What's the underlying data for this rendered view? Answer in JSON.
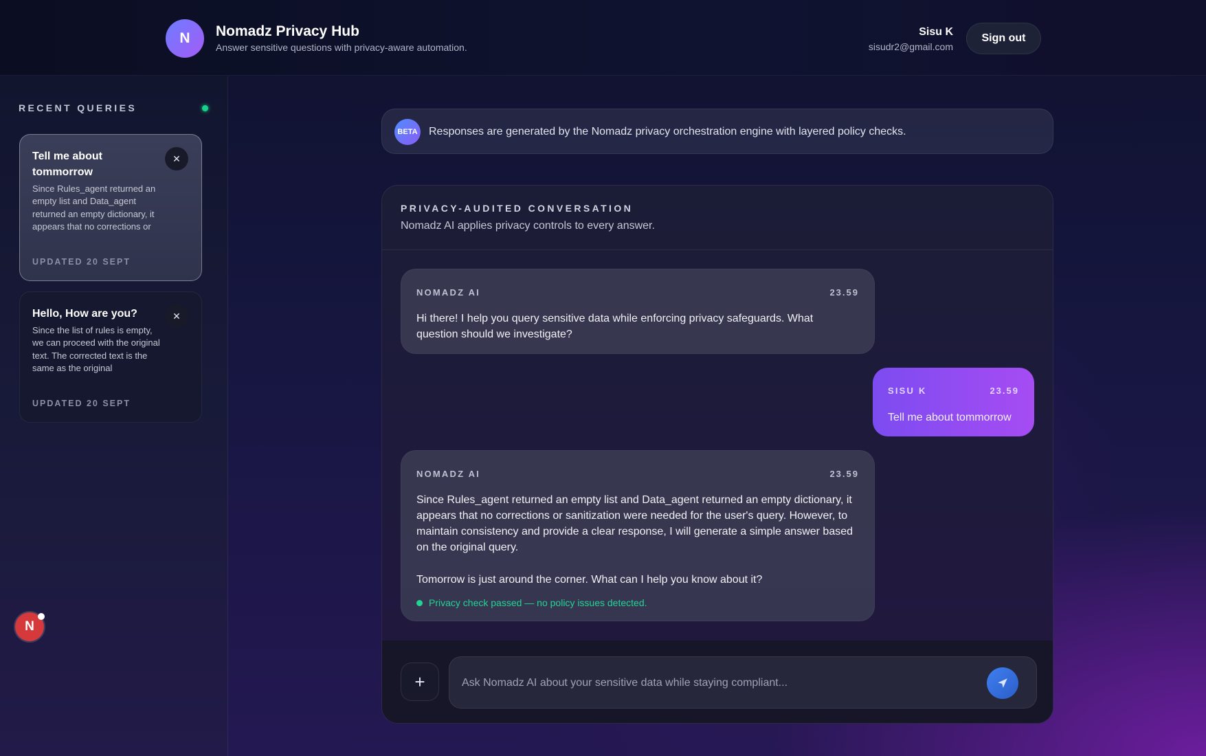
{
  "app": {
    "logo_letter": "N",
    "title": "Nomadz Privacy Hub",
    "subtitle": "Answer sensitive questions with privacy-aware automation."
  },
  "user": {
    "name": "Sisu K",
    "email": "sisudr2@gmail.com",
    "sign_out_label": "Sign out"
  },
  "sidebar": {
    "heading": "RECENT QUERIES",
    "queries": [
      {
        "title": "Tell me about tommorrow",
        "snippet": "Since Rules_agent returned an empty list and Data_agent returned an empty dictionary, it appears that no corrections or",
        "updated": "UPDATED 20 SEPT",
        "active": true
      },
      {
        "title": "Hello, How are you?",
        "snippet": "Since the list of rules is empty, we can proceed with the original text. The corrected text is the same as the original",
        "updated": "UPDATED 20 SEPT",
        "active": false
      }
    ],
    "fab_letter": "N"
  },
  "banner": {
    "badge": "BETA",
    "text": "Responses are generated by the Nomadz privacy orchestration engine with layered policy checks."
  },
  "chat": {
    "title": "PRIVACY-AUDITED CONVERSATION",
    "subtitle": "Nomadz AI applies privacy controls to every answer.",
    "messages": [
      {
        "sender": "NOMADZ AI",
        "time": "23.59",
        "text": "Hi there! I help you query sensitive data while enforcing privacy safeguards. What question should we investigate?"
      },
      {
        "sender": "SISU K",
        "time": "23.59",
        "text": "Tell me about tommorrow"
      },
      {
        "sender": "NOMADZ AI",
        "time": "23.59",
        "text": "Since Rules_agent returned an empty list and Data_agent returned an empty dictionary, it appears that no corrections or sanitization were needed for the user's query. However, to maintain consistency and provide a clear response, I will generate a simple answer based on the original query.",
        "text2": "Tomorrow is just around the corner. What can I help you know about it?",
        "check": "Privacy check passed — no policy issues detected."
      }
    ],
    "composer": {
      "placeholder": "Ask Nomadz AI about your sensitive data while staying compliant...",
      "add_icon": "plus-icon",
      "send_icon": "send-icon"
    }
  },
  "colors": {
    "accent_purple": "#a45cf6",
    "status_green": "#17d28a",
    "send_blue": "#3f7ff0"
  }
}
